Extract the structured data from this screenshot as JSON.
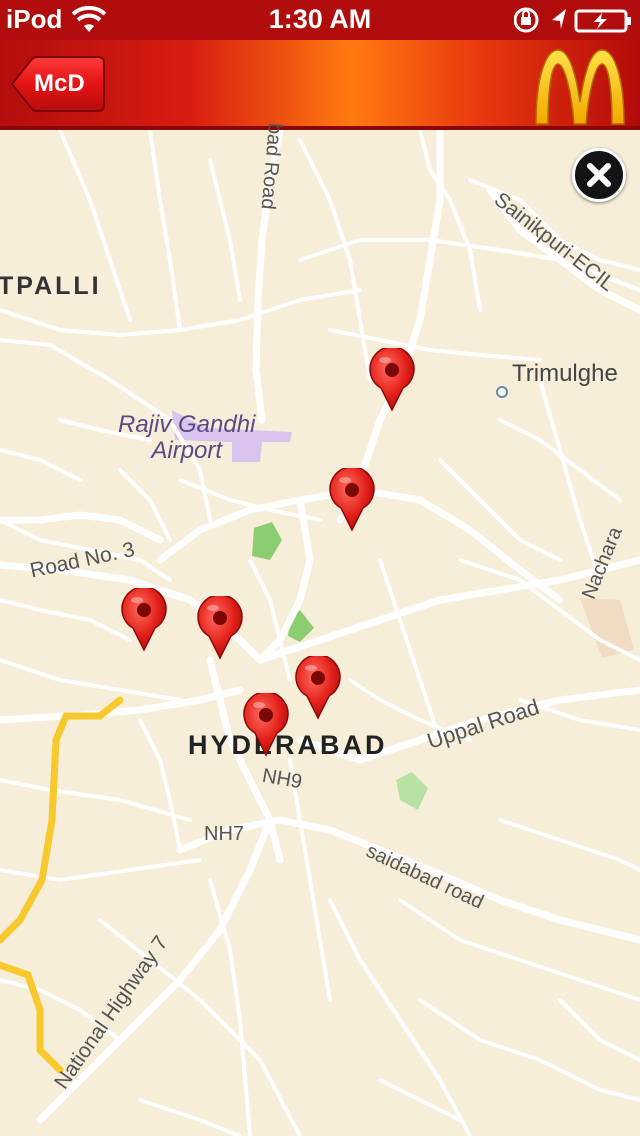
{
  "status_bar": {
    "carrier": "iPod",
    "time": "1:30 AM"
  },
  "nav": {
    "back_label": "McD"
  },
  "map": {
    "labels": {
      "kukatpalli": "TPALLI",
      "airport": "Rajiv Gandhi\nAirport",
      "trimulgherry": "Trimulghe",
      "road3": "Road No. 3",
      "hyderabad": "HYDERABAD",
      "uppal": "Uppal Road",
      "nh9": "NH9",
      "nh7": "NH7",
      "saidabad": "saidabad road",
      "nh7long": "National Highway 7",
      "sainikpuri": "Sainikpuri-ECIL",
      "nacharam": "Nachara",
      "bad_road": "bad Road"
    }
  }
}
